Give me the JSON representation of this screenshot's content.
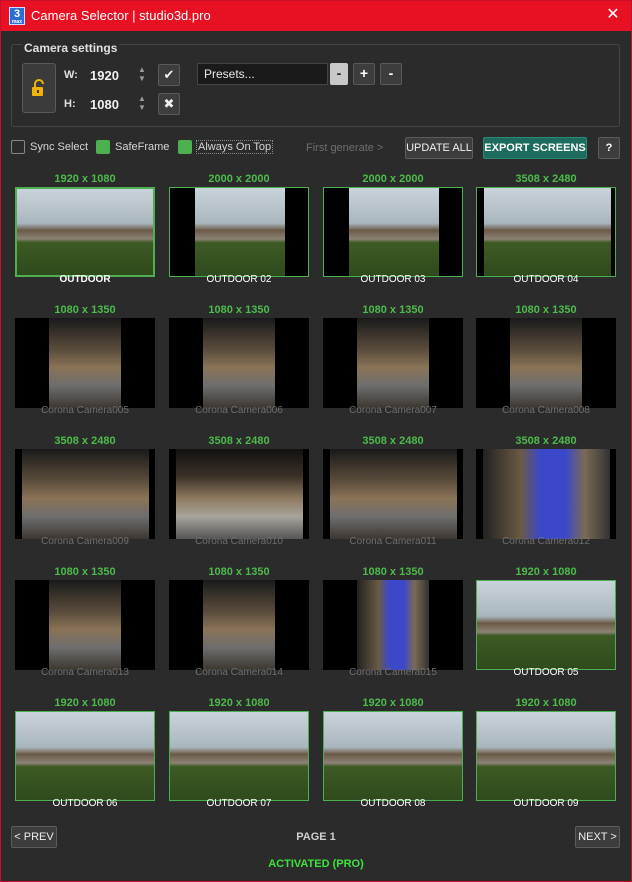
{
  "window": {
    "title": "Camera Selector | studio3d.pro",
    "app_icon_text": "3",
    "app_icon_sub": "max"
  },
  "settings": {
    "group_title": "Camera settings",
    "width_label": "W:",
    "width_value": "1920",
    "height_label": "H:",
    "height_value": "1080",
    "confirm_icon": "✔",
    "cancel_icon": "✖",
    "presets_value": "Presets...",
    "presets_minus": "-",
    "presets_add": "+",
    "presets_remove": "-"
  },
  "options": {
    "sync_select": {
      "label": "Sync Select",
      "checked": false
    },
    "safe_frame": {
      "label": "SafeFrame",
      "checked": true
    },
    "always_on_top": {
      "label": "Always On Top",
      "checked": true
    },
    "first_generate": "First generate >",
    "update_all": "UPDATE ALL",
    "export_screens": "EXPORT SCREENS",
    "help": "?"
  },
  "cameras": [
    {
      "dim": "1920 x 1080",
      "name": "OUTDOOR",
      "state": "selected",
      "scene": "outdoor",
      "aspect": 1.778
    },
    {
      "dim": "2000 x 2000",
      "name": "OUTDOOR 02",
      "state": "done",
      "scene": "outdoor",
      "aspect": 1.0
    },
    {
      "dim": "2000 x 2000",
      "name": "OUTDOOR 03",
      "state": "done",
      "scene": "outdoor",
      "aspect": 1.0
    },
    {
      "dim": "3508 x 2480",
      "name": "OUTDOOR 04",
      "state": "framed",
      "scene": "outdoor",
      "aspect": 1.414
    },
    {
      "dim": "1080 x 1350",
      "name": "Corona Camera005",
      "state": "pending",
      "scene": "interior",
      "aspect": 0.8
    },
    {
      "dim": "1080 x 1350",
      "name": "Corona Camera006",
      "state": "pending",
      "scene": "interior",
      "aspect": 0.8
    },
    {
      "dim": "1080 x 1350",
      "name": "Corona Camera007",
      "state": "pending",
      "scene": "interior",
      "aspect": 0.8
    },
    {
      "dim": "1080 x 1350",
      "name": "Corona Camera008",
      "state": "pending",
      "scene": "interior",
      "aspect": 0.8
    },
    {
      "dim": "3508 x 2480",
      "name": "Corona Camera009",
      "state": "pending",
      "scene": "interior",
      "aspect": 1.414
    },
    {
      "dim": "3508 x 2480",
      "name": "Corona Camera010",
      "state": "pending",
      "scene": "bedroom",
      "aspect": 1.414
    },
    {
      "dim": "3508 x 2480",
      "name": "Corona Camera011",
      "state": "pending",
      "scene": "interior",
      "aspect": 1.414
    },
    {
      "dim": "3508 x 2480",
      "name": "Corona Camera012",
      "state": "pending",
      "scene": "blue",
      "aspect": 1.414
    },
    {
      "dim": "1080 x 1350",
      "name": "Corona Camera013",
      "state": "pending",
      "scene": "interior",
      "aspect": 0.8
    },
    {
      "dim": "1080 x 1350",
      "name": "Corona Camera014",
      "state": "pending",
      "scene": "interior",
      "aspect": 0.8
    },
    {
      "dim": "1080 x 1350",
      "name": "Corona Camera015",
      "state": "pending",
      "scene": "blue",
      "aspect": 0.8
    },
    {
      "dim": "1920 x 1080",
      "name": "OUTDOOR 05",
      "state": "framed",
      "scene": "outdoor",
      "aspect": 1.778
    },
    {
      "dim": "1920 x 1080",
      "name": "OUTDOOR 06",
      "state": "framed",
      "scene": "outdoor",
      "aspect": 1.778
    },
    {
      "dim": "1920 x 1080",
      "name": "OUTDOOR 07",
      "state": "framed",
      "scene": "outdoor",
      "aspect": 1.778
    },
    {
      "dim": "1920 x 1080",
      "name": "OUTDOOR 08",
      "state": "framed",
      "scene": "outdoor",
      "aspect": 1.778
    },
    {
      "dim": "1920 x 1080",
      "name": "OUTDOOR 09",
      "state": "framed",
      "scene": "outdoor",
      "aspect": 1.778
    }
  ],
  "pager": {
    "prev": "< PREV",
    "page": "PAGE 1",
    "next": "NEXT >"
  },
  "status": "ACTIVATED (PRO)",
  "colors": {
    "titlebar": "#e81123",
    "accent_green": "#4caf50",
    "dim_green": "#4cbb4c",
    "export_teal": "#1d6b5c",
    "status_green": "#3ee23e"
  }
}
